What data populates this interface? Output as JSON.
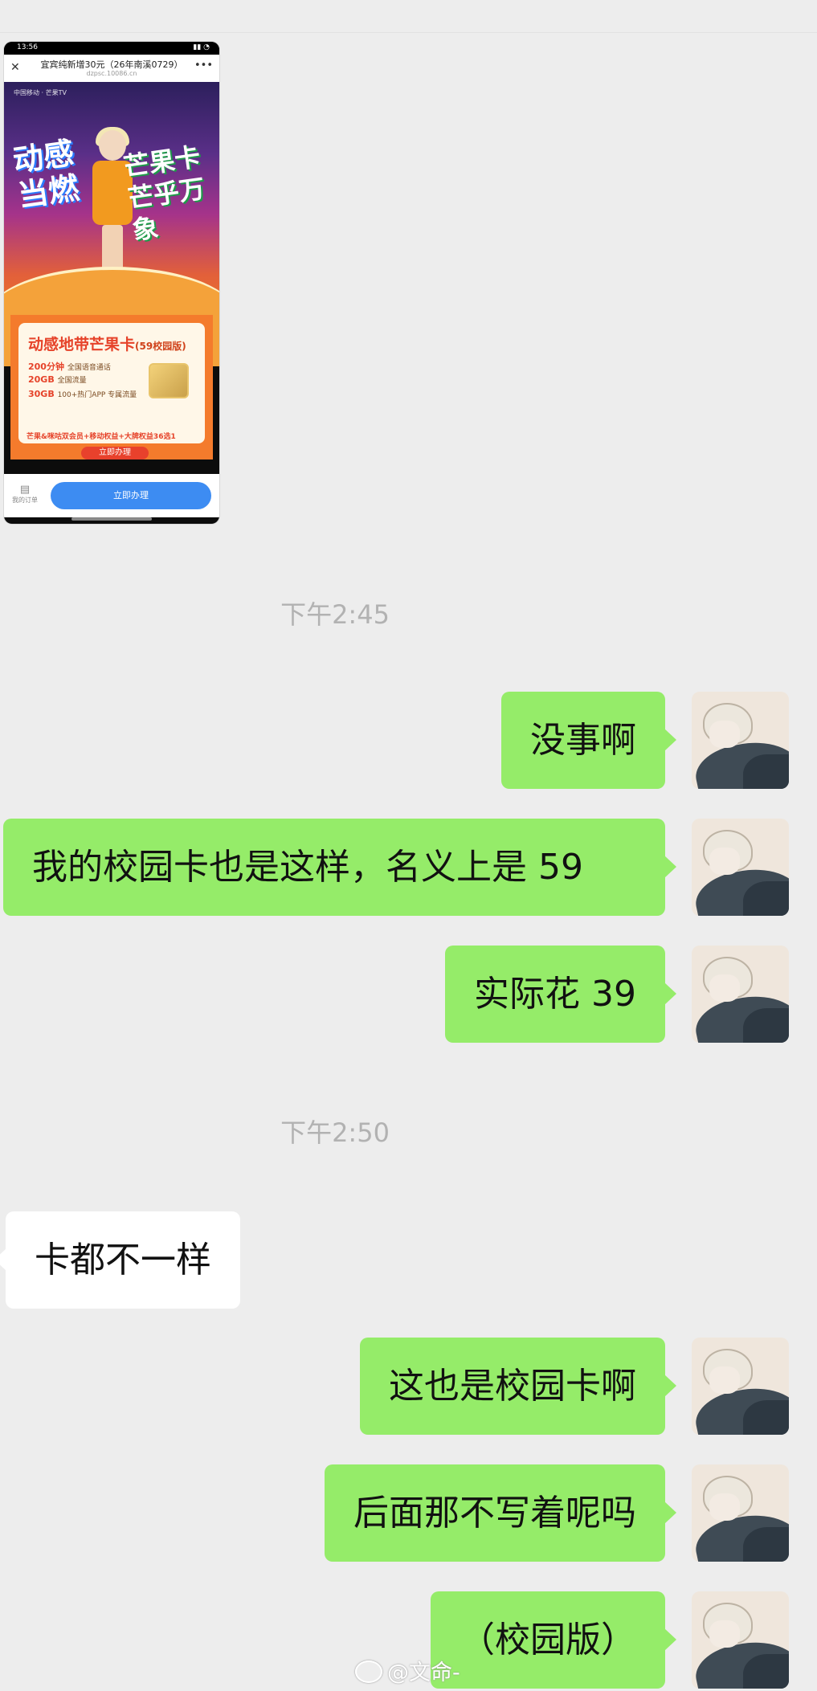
{
  "image_message": {
    "status_time": "13:56",
    "page_title": "宜宾纯新增30元（26年南溪0729）",
    "page_url": "dzpsc.10086.cn",
    "brand_strip": "中国移动 · 芒果TV",
    "banner_left": "动感当燃",
    "banner_right": "芒果卡 芒乎万象",
    "card_title": "动感地带芒果卡",
    "card_title_suffix": "(59校园版)",
    "feature_1": "200分钟",
    "feature_1_desc": "全国语音通话",
    "feature_2": "20GB",
    "feature_2_desc": "全国流量",
    "feature_3": "30GB",
    "feature_3_desc": "100+热门APP 专属流量",
    "perks": "芒果&咪咕双会员+移动权益+大牌权益36选1",
    "card_cta": "立即办理",
    "orders_label": "我的订单",
    "apply_button": "立即办理"
  },
  "timestamps": [
    "下午2:45",
    "下午2:50"
  ],
  "messages": [
    {
      "side": "right",
      "text": "没事啊"
    },
    {
      "side": "right",
      "text": "我的校园卡也是这样，名义上是 59"
    },
    {
      "side": "right",
      "text": "实际花 39"
    },
    {
      "side": "left",
      "text": "卡都不一样"
    },
    {
      "side": "right",
      "text": "这也是校园卡啊"
    },
    {
      "side": "right",
      "text": "后面那不写着呢吗"
    },
    {
      "side": "right",
      "text": "（校园版）"
    }
  ],
  "watermark": "@文命-"
}
